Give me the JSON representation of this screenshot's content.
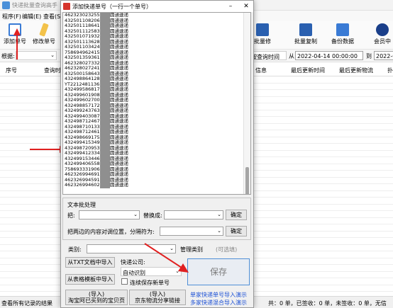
{
  "background_window": {
    "title": "快递批量查询高手",
    "menu": [
      "程序(F)",
      "编辑(E)",
      "查看(S)"
    ],
    "toolbar": [
      {
        "label": "添加单号",
        "icon": "document-icon",
        "color": "#3a7bd5"
      },
      {
        "label": "修改单号",
        "icon": "pencil-icon",
        "color": "#e0a020"
      },
      {
        "label": "批量修",
        "icon": "batch-icon",
        "color": "#2a60b0"
      },
      {
        "label": "批量复制",
        "icon": "copy-icon",
        "color": "#2a60b0"
      },
      {
        "label": "备份数据",
        "icon": "save-icon",
        "color": "#3a7bd5"
      },
      {
        "label": "会员中",
        "icon": "globe-icon",
        "color": "#1a3f8a"
      }
    ],
    "filter": {
      "root_label": "根据:",
      "date_mode": "按查询时间",
      "from_label": "从",
      "from_date": "2022-04-14 00:00:00",
      "to_label": "到",
      "to_date": "2022-0"
    },
    "columns": [
      "序号",
      "查询时",
      "信息",
      "最后更新时间",
      "最后更新物流",
      "扑"
    ],
    "status_bar": {
      "left": "查看所有记录的结果",
      "right": "共：0 单，已签收：0 单，未签收：0 单，无信"
    }
  },
  "dialog": {
    "title": "添加快递单号（一行一个单号）",
    "minimize": "–",
    "close": "✕",
    "tracking_numbers": [
      "4623230232558",
      "4325011082069",
      "4325011186411",
      "4325011125837",
      "4325010719323",
      "4325011136286",
      "4325011034249",
      "7586949624150",
      "4325013593613",
      "4623280273328",
      "4623280272415",
      "4325001586433",
      "4324988641283",
      "YT2212481136",
      "4324995868173",
      "4324996019081",
      "4324996027004",
      "4324988571720",
      "4324992437634",
      "4324994030874",
      "4324987124675",
      "4324987101331",
      "4324987124617",
      "4324986691754",
      "4324994153499",
      "4324987209538",
      "4324994123346",
      "4324991534469",
      "4324994065584",
      "7586933319063",
      "4623269946918",
      "4623269945915",
      "4623269946020"
    ],
    "courier_name": "圆通速递",
    "text_batch_title": "文本批处理",
    "replace_label": "把:",
    "replace_with_label": "替换成:",
    "confirm_label": "确定",
    "move_content_label": "把两边的内容对调位置，分隔符为:",
    "category_label": "类别:",
    "manage_category": "管理类别",
    "optional": "(可选填)",
    "import_txt": "从TXT文档中导入",
    "courier_company_label": "快递公司:",
    "courier_company_value": "自动识别",
    "import_template": "从表格模板中导入",
    "keep_saving": "连续保存新单号",
    "import_taobao": [
      "(导入)",
      "淘宝阿已买到的宝贝页"
    ],
    "import_jd": [
      "(导入)",
      "京东物流分享链接"
    ],
    "link_single": "单家快递单号导入演示",
    "link_multi": "多家快递混合导入演示",
    "save_label": "保存"
  }
}
